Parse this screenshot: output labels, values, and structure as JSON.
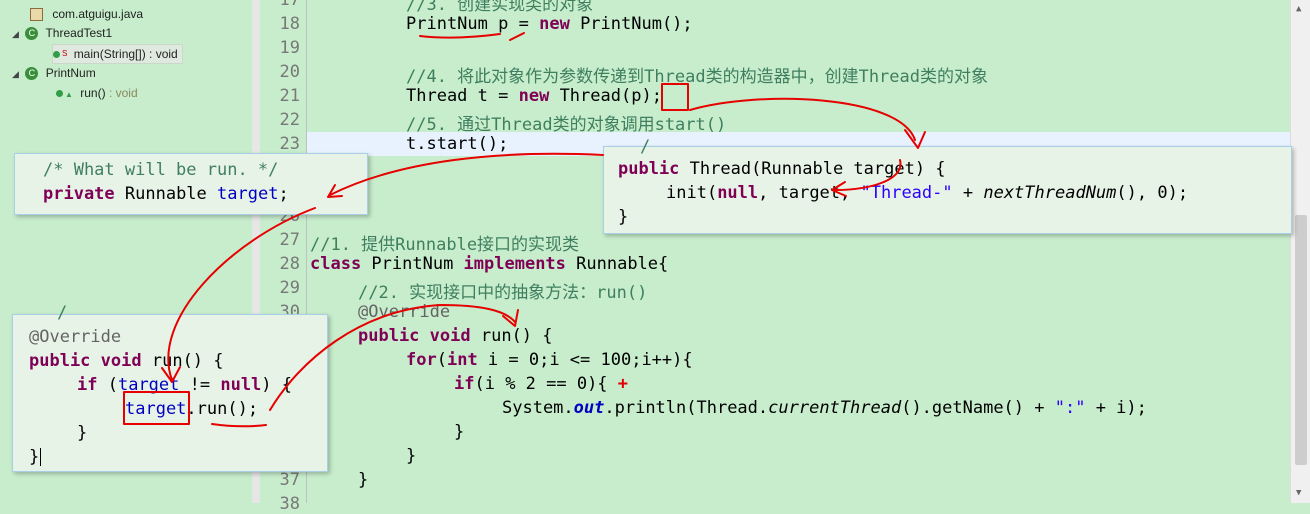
{
  "outline": {
    "items": [
      {
        "label": "com.atguigu.java",
        "icon": "package-icon"
      },
      {
        "label": "ThreadTest1",
        "icon": "class-icon"
      },
      {
        "label": "main(String[]) : void",
        "icon": "method-icon"
      },
      {
        "label": "PrintNum",
        "icon": "class-icon"
      },
      {
        "label": "run()",
        "type_suffix": " : void",
        "icon": "method-icon"
      }
    ]
  },
  "editor": {
    "line_numbers": [
      "17",
      "18",
      "19",
      "20",
      "21",
      "22",
      "23",
      "26",
      "27",
      "28",
      "29",
      "30",
      "37",
      "38"
    ],
    "line17": "//3. 创建实现类的对象",
    "line18": {
      "type": "PrintNum",
      "var": "p",
      "eq": " = ",
      "kw": "new",
      "ctor": " PrintNum();"
    },
    "line20": "//4. 将此对象作为参数传递到Thread类的构造器中，创建Thread类的对象",
    "line21": {
      "type": "Thread",
      "var": " t = ",
      "kw": "new",
      "ctor": " Thread(",
      "arg": "p",
      "end": ");"
    },
    "line22": "//5. 通过Thread类的对象调用start()",
    "line23": "t.start();",
    "line27": "//1. 提供Runnable接口的实现类",
    "line28": {
      "kw1": "class",
      "name": " PrintNum ",
      "kw2": "implements",
      "iface": " Runnable{"
    },
    "line29": "//2. 实现接口中的抽象方法：run()",
    "line30": "@Override",
    "line31": {
      "kw1": "public",
      "kw2": "void",
      "rest": " run() {"
    },
    "line32": {
      "kw": "for",
      "rest1": "(",
      "kw2": "int",
      "rest2": " i = 0;i <= 100;i++){"
    },
    "line33": {
      "kw": "if",
      "rest": "(i % 2 == 0){ ",
      "plus": "+"
    },
    "line34": {
      "p1": "System.",
      "out": "out",
      "p2": ".println(Thread.",
      "ct": "currentThread",
      "p3": "().getName() + ",
      "str": "\":\"",
      "p4": " + i);"
    },
    "line35": "}",
    "line36": "}",
    "line37": "}"
  },
  "popup_field": {
    "comment": "/* What will be run. */",
    "kw": "private",
    "type": " Runnable ",
    "field": "target",
    "semi": ";"
  },
  "popup_ctor": {
    "frag_top": "/",
    "kw": "public",
    "sig1": " Thread(Runnable target) {",
    "init1": "init(",
    "null_kw": "null",
    "init2": ", target, ",
    "str": "\"Thread-\"",
    "init3": " + ",
    "ntn": "nextThreadNum",
    "init4": "(), 0);",
    "close": "}"
  },
  "popup_run": {
    "frag_top": "/",
    "ann": "@Override",
    "kw1": "public",
    "kw2": "void",
    "name": " run() {",
    "if_kw": "if",
    "if_open": " (",
    "field": "target",
    "cmp": " != ",
    "null_kw": "null",
    "if_close": ") {",
    "call_field": "target",
    "call_rest": ".run();",
    "close_inner": "}",
    "close_outer": "}"
  },
  "colors": {
    "background": "#c7edcc",
    "keyword": "#7f0055",
    "comment": "#3f7f5f",
    "string": "#2a00ff",
    "field": "#0000c0",
    "annotation_mark": "#ff0000"
  }
}
